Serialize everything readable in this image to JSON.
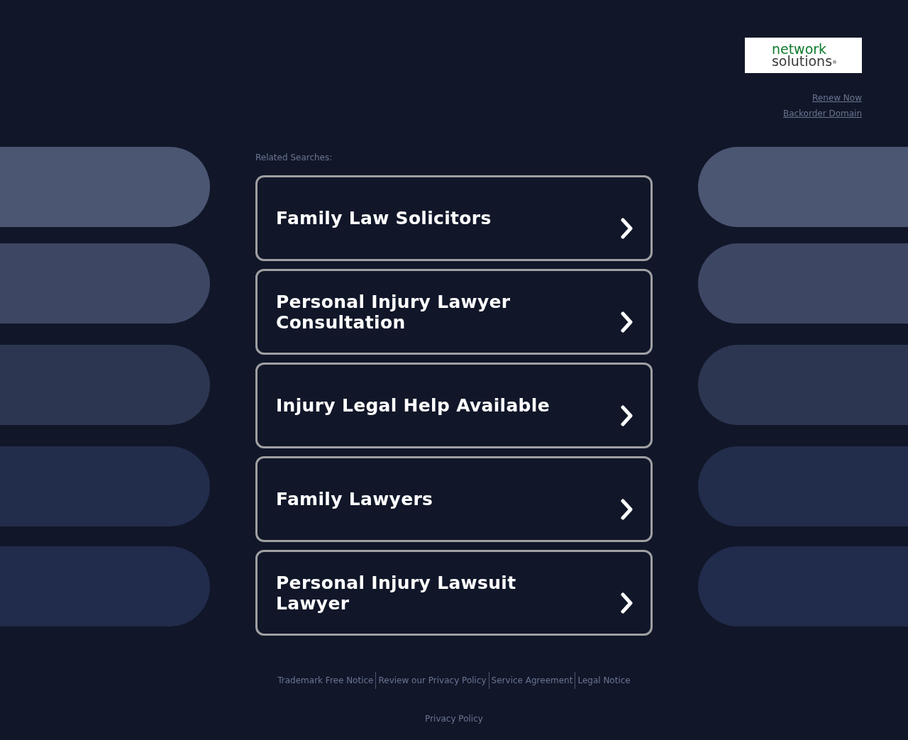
{
  "logo": {
    "line_1": "network",
    "line_2": "solutions",
    "mark": "®"
  },
  "header_links": [
    "Renew Now",
    "Backorder Domain"
  ],
  "related_label": "Related Searches:",
  "searches": [
    "Family Law Solicitors",
    "Personal Injury Lawyer Consultation",
    "Injury Legal Help Available",
    "Family Lawyers",
    "Personal Injury Lawsuit Lawyer"
  ],
  "footer_links": [
    "Trademark Free Notice",
    "Review our Privacy Policy",
    "Service Agreement",
    "Legal Notice"
  ],
  "footer_bottom": "Privacy Policy"
}
